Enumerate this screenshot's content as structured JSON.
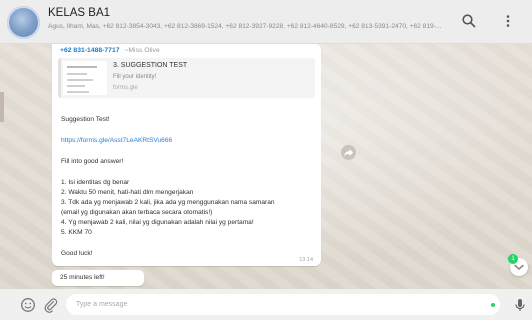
{
  "header": {
    "title": "KELAS BA1",
    "members": "Agus, Ilham, Mas, +62 812-3854-3043, +62 812-3869-1524, +62 812-3927-9228, +62 812-4640-8529, +62 813-5391-2470, +62 819-...",
    "search_icon": "search-icon",
    "menu_icon": "more-vertical-icon"
  },
  "message": {
    "sender_phone": "+62 831-1488-7717",
    "sender_alias": "~Miss Olive",
    "preview": {
      "title": "3. SUGGESTION TEST",
      "description": "Fill your identity!",
      "site": "forms.gle"
    },
    "lines": [
      "Suggestion Test!",
      "https://forms.gle/Asst7LeAKRtSVu666",
      "Fill into good answer!",
      "1. Isi identitas dg benar",
      "2. Waktu 50 menit, hati-hati dlm mengerjakan",
      "3. Tdk ada yg menjawab 2 kali, jika ada yg menggunakan nama samaran",
      "(email yg digunakan akan terbaca secara otomatis!)",
      "4. Yg menjawab 2 kali, nilai yg digunakan adalah nilai yg pertama!",
      "5. KKM 70",
      "Good luck!"
    ],
    "time": "13.14"
  },
  "message2": {
    "text": "25 minutes left!"
  },
  "unread_count": "1",
  "composer": {
    "placeholder": "Type a message",
    "emoji_icon": "emoji-icon",
    "attach_icon": "paperclip-icon",
    "mic_icon": "microphone-icon"
  },
  "colors": {
    "accent": "#25d366",
    "link": "#2a7fd4",
    "header_bg": "#ededed"
  }
}
